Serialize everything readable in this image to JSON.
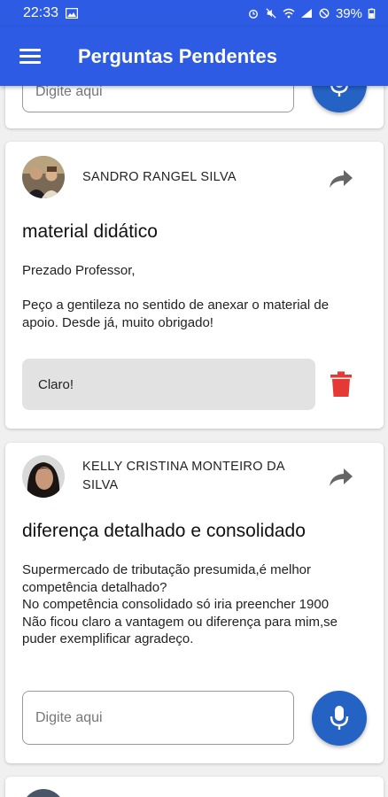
{
  "status_bar": {
    "time": "22:33",
    "battery": "39%"
  },
  "app_bar": {
    "title": "Perguntas Pendentes",
    "menu_icon": "hamburger-menu-icon"
  },
  "partial_card": {
    "input_placeholder": "Digite aqui"
  },
  "questions": [
    {
      "author": "SANDRO RANGEL SILVA",
      "title": "material didático",
      "body": "Prezado Professor,\n\nPeço a gentileza no sentido de anexar o material de apoio. Desde já, muito obrigado!",
      "answer": "Claro!"
    },
    {
      "author": "KELLY CRISTINA MONTEIRO DA SILVA",
      "title": "diferença detalhado e consolidado",
      "body": "Supermercado de tributação presumida,é melhor competência detalhado?\nNo competência consolidado só iria preencher 1900\nNão ficou claro a vantagem ou diferença para mim,se puder exemplificar agradeço.",
      "input_placeholder": "Digite aqui"
    }
  ],
  "colors": {
    "primary": "#2d5be3",
    "mic_button": "#2462c4",
    "delete": "#e53935",
    "answer_bg": "#e2e2e2"
  }
}
